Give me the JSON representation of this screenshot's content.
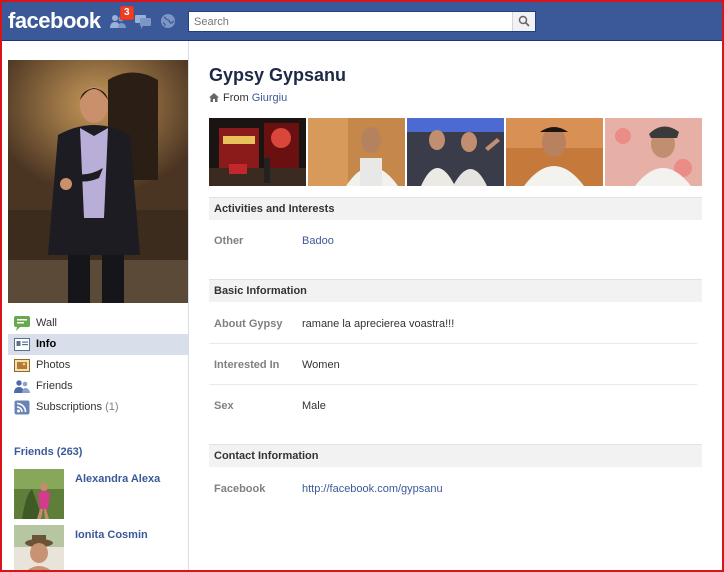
{
  "header": {
    "logo": "facebook",
    "friend_requests_count": "3",
    "search": {
      "placeholder": "Search"
    }
  },
  "profile": {
    "name": "Gypsy Gypsanu",
    "from_label": "From",
    "hometown": "Giurgiu"
  },
  "sidebar": {
    "items": [
      {
        "label": "Wall",
        "icon": "wall-icon"
      },
      {
        "label": "Info",
        "icon": "info-icon",
        "active": true
      },
      {
        "label": "Photos",
        "icon": "photos-icon"
      },
      {
        "label": "Friends",
        "icon": "friends-icon"
      },
      {
        "label": "Subscriptions",
        "count": "(1)",
        "icon": "rss-icon"
      }
    ],
    "friends_title": "Friends (263)",
    "friends": [
      {
        "name": "Alexandra Alexa"
      },
      {
        "name": "Ionita Cosmin"
      }
    ]
  },
  "sections": {
    "activities": {
      "title": "Activities and Interests",
      "rows": [
        {
          "label": "Other",
          "value": "Badoo"
        }
      ]
    },
    "basic": {
      "title": "Basic Information",
      "rows": [
        {
          "label": "About Gypsy",
          "value": "ramane la aprecierea voastra!!!"
        },
        {
          "label": "Interested In",
          "value": "Women"
        },
        {
          "label": "Sex",
          "value": "Male"
        }
      ]
    },
    "contact": {
      "title": "Contact Information",
      "rows": [
        {
          "label": "Facebook",
          "value": "http://facebook.com/gypsanu"
        }
      ]
    }
  },
  "colors": {
    "brand": "#3b5998",
    "frame_border": "#d8141b",
    "badge": "#f03d25",
    "section_header_bg": "#f2f2f2"
  }
}
